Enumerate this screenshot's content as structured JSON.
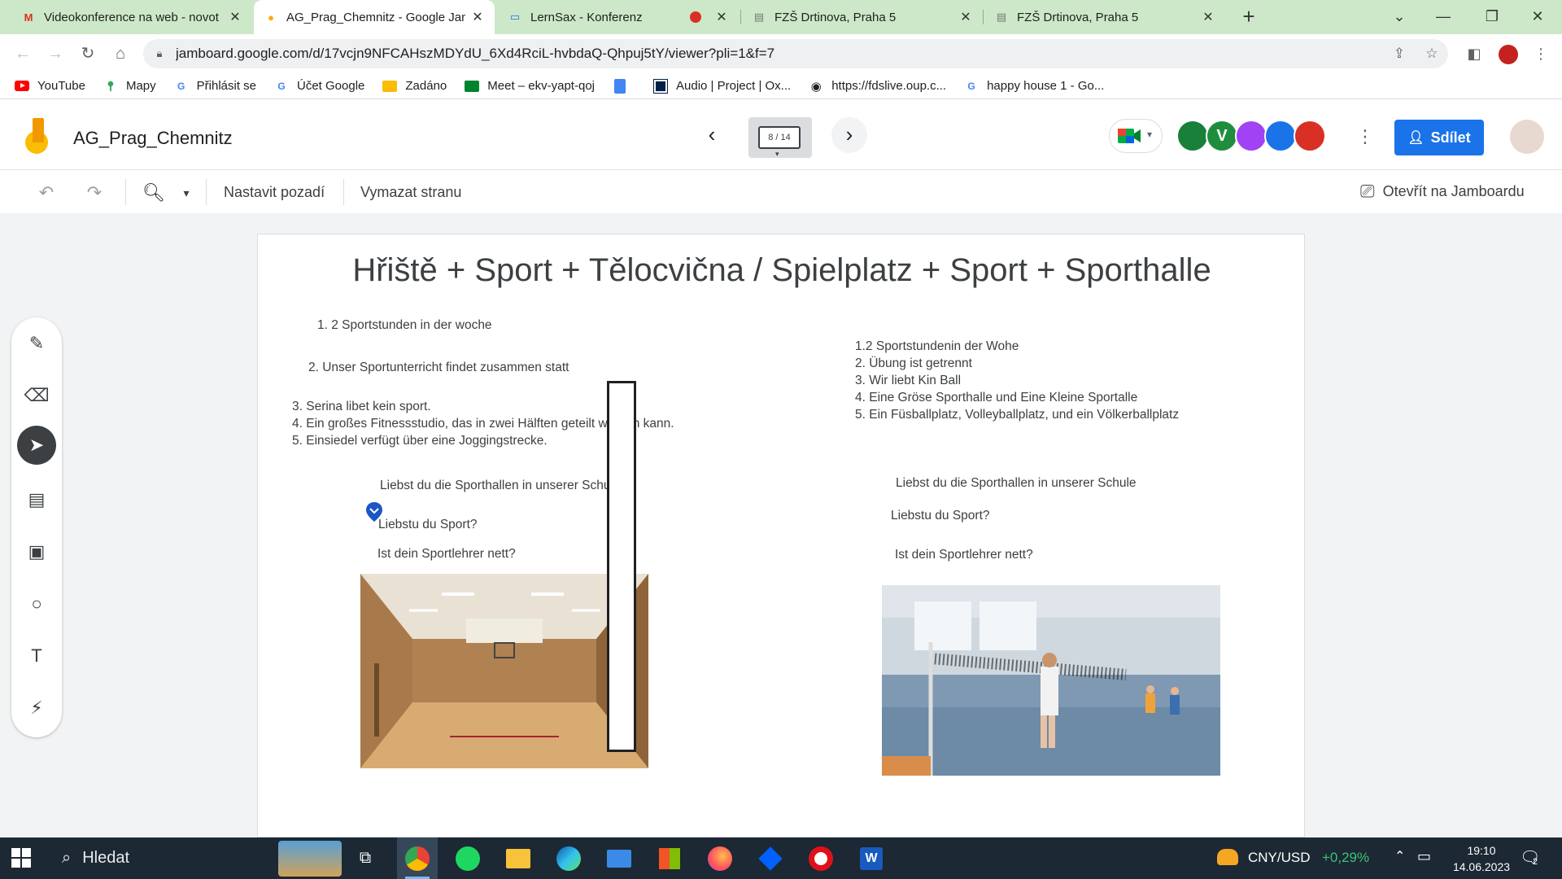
{
  "browser": {
    "tabs": [
      {
        "title": "Videokonference na web - novot",
        "icon": "gmail-icon"
      },
      {
        "title": "AG_Prag_Chemnitz - Google Jam",
        "icon": "jamboard-icon",
        "active": true
      },
      {
        "title": "LernSax - Konferenz",
        "icon": "laptop-icon",
        "recording": true
      },
      {
        "title": "FZŠ Drtinova, Praha 5",
        "icon": "page-icon"
      },
      {
        "title": "FZŠ Drtinova, Praha 5",
        "icon": "page-icon"
      }
    ],
    "url": "jamboard.google.com/d/17vcjn9NFCAHszMDYdU_6Xd4RciL-hvbdaQ-Qhpuj5tY/viewer?pli=1&f=7",
    "bookmarks": [
      {
        "label": "YouTube",
        "icon": "youtube-icon"
      },
      {
        "label": "Mapy",
        "icon": "maps-pin-icon"
      },
      {
        "label": "Přihlásit se",
        "icon": "google-g-icon"
      },
      {
        "label": "Účet Google",
        "icon": "google-g-icon"
      },
      {
        "label": "Zadáno",
        "icon": "classroom-icon"
      },
      {
        "label": "Meet – ekv-yapt-qoj",
        "icon": "meet-icon"
      },
      {
        "label": "",
        "icon": "docs-icon"
      },
      {
        "label": "Audio | Project | Ox...",
        "icon": "oxford-icon"
      },
      {
        "label": "https://fdslive.oup.c...",
        "icon": "globe-icon"
      },
      {
        "label": "happy house 1 - Go...",
        "icon": "google-g-icon"
      }
    ]
  },
  "jamboard": {
    "title": "AG_Prag_Chemnitz",
    "frame_indicator": "8 / 14",
    "share_label": "Sdílet",
    "collaborators": [
      {
        "letter": "",
        "color": "#188038"
      },
      {
        "letter": "V",
        "color": "#1e8e3e"
      },
      {
        "letter": "",
        "color": "#a142f4"
      },
      {
        "letter": "",
        "color": "#1a73e8"
      },
      {
        "letter": "",
        "color": "#d93025"
      }
    ],
    "toolbar": {
      "set_background": "Nastavit pozadí",
      "clear_frame": "Vymazat stranu",
      "open_in_jamboard": "Otevřít na Jamboardu"
    }
  },
  "board": {
    "title": "Hřiště + Sport + Tělocvična / Spielplatz + Sport + Sporthalle",
    "left": {
      "item1": "1. 2 Sportstunden in der woche",
      "item2": "2. Unser Sportunterricht findet zusammen statt",
      "item3": "3. Serina libet kein sport.",
      "item4": "4. Ein großes Fitnessstudio, das in zwei Hälften geteilt werden kann.",
      "item5": "5. Einsiedel verfügt über eine Joggingstrecke.",
      "q1": "Liebst du die Sporthallen in unserer Schule",
      "q2": "Liebstu du Sport?",
      "q3": "Ist dein Sportlehrer nett?"
    },
    "right": {
      "item1": "1.2 Sportstundenin der Wohe",
      "item2": "2. Übung ist getrennt",
      "item3": "3. Wir liebt Kin Ball",
      "item4": "4. Eine Gröse Sporthalle und Eine Kleine Sportalle",
      "item5": "5. Ein Füsballplatz, Volleyballplatz, und ein Völkerballplatz",
      "q1": "Liebst du die Sporthallen in unserer Schule",
      "q2": "Liebstu du Sport?",
      "q3": "Ist dein Sportlehrer nett?"
    }
  },
  "taskbar": {
    "search_label": "Hledat",
    "ticker": "CNY/USD",
    "ticker_change": "+0,29%",
    "time": "19:10",
    "date": "14.06.2023",
    "notifications": "2"
  }
}
